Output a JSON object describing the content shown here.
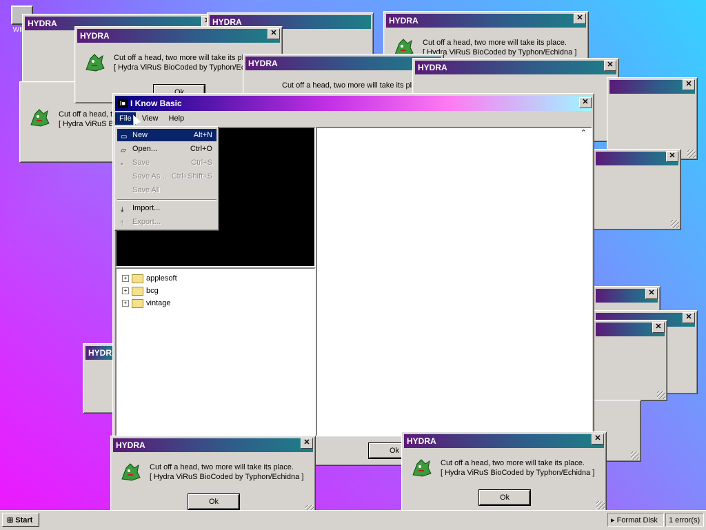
{
  "desktop": {
    "icon_label": "WIND"
  },
  "hydra": {
    "title": "HYDRA",
    "line1": "Cut off a head, two more will take its place.",
    "line2": "[ Hydra ViRuS BioCoded by Typhon/Echidna ]",
    "ok": "Ok"
  },
  "main": {
    "title": "I Know Basic",
    "menus": [
      "File",
      "View",
      "Help"
    ],
    "tree": [
      "applesoft",
      "bcg",
      "vintage"
    ]
  },
  "file_menu": {
    "items": [
      {
        "label": "New",
        "shortcut": "Alt+N",
        "state": "selected"
      },
      {
        "label": "Open...",
        "shortcut": "Ctrl+O",
        "state": "enabled"
      },
      {
        "label": "Save",
        "shortcut": "Ctrl+S",
        "state": "disabled"
      },
      {
        "label": "Save As...",
        "shortcut": "Ctrl+Shift+S",
        "state": "disabled"
      },
      {
        "label": "Save All",
        "shortcut": "",
        "state": "disabled"
      },
      {
        "label": "Import...",
        "shortcut": "",
        "state": "enabled"
      },
      {
        "label": "Export...",
        "shortcut": "",
        "state": "disabled"
      }
    ]
  },
  "taskbar": {
    "start": "Start",
    "format_disk": "Format Disk",
    "errors": "1 error(s)"
  }
}
